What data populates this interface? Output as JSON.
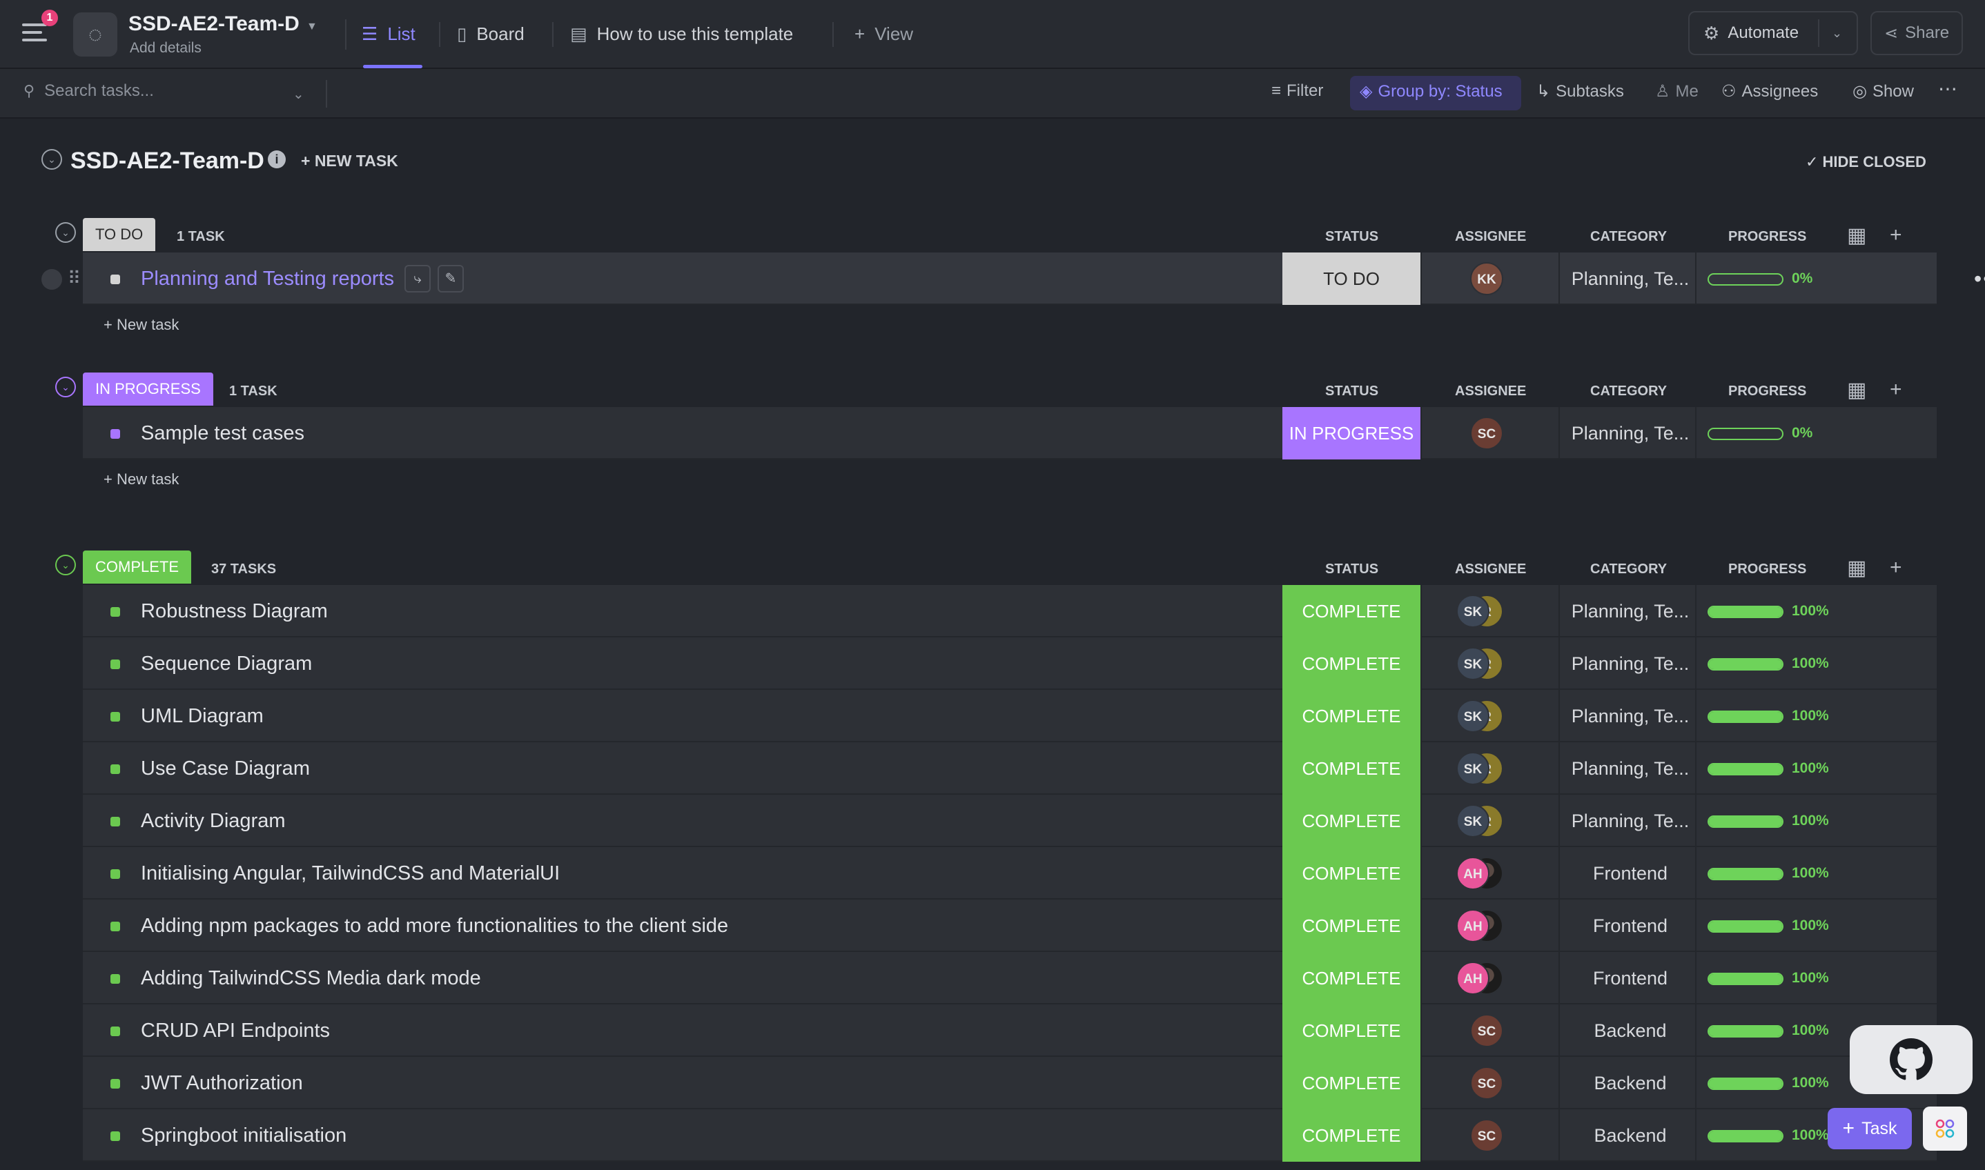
{
  "topbar": {
    "notification_count": "1",
    "workspace_name": "SSD-AE2-Team-D",
    "add_details": "Add details",
    "tabs": [
      {
        "label": "List",
        "icon": "list-icon",
        "active": true
      },
      {
        "label": "Board",
        "icon": "board-icon",
        "active": false
      },
      {
        "label": "How to use this template",
        "icon": "doc-icon",
        "active": false
      },
      {
        "label": "View",
        "icon": "plus-icon",
        "active": false
      }
    ],
    "automate_label": "Automate",
    "share_label": "Share"
  },
  "toolbar": {
    "search_placeholder": "Search tasks...",
    "filter_label": "Filter",
    "group_by_label": "Group by: Status",
    "subtasks_label": "Subtasks",
    "me_label": "Me",
    "assignees_label": "Assignees",
    "show_label": "Show"
  },
  "list": {
    "title": "SSD-AE2-Team-D",
    "new_task_label": "+ NEW TASK",
    "hide_closed_label": "HIDE CLOSED"
  },
  "columns": {
    "status": "STATUS",
    "assignee": "ASSIGNEE",
    "category": "CATEGORY",
    "progress": "PROGRESS"
  },
  "new_task_row_label": "+ New task",
  "colors": {
    "todo": "#d3d3d3",
    "in_progress": "#a875ff",
    "complete": "#6bc950",
    "accent": "#7b68ee",
    "progress": "#6ed35a"
  },
  "groups": {
    "todo": {
      "label": "TO DO",
      "count": "1 TASK",
      "tasks": [
        {
          "name": "Planning and Testing reports",
          "status": "TO DO",
          "assignees": [
            "KK"
          ],
          "category": "Planning, Te...",
          "progress": "0%"
        }
      ]
    },
    "in_progress": {
      "label": "IN PROGRESS",
      "count": "1 TASK",
      "tasks": [
        {
          "name": "Sample test cases",
          "status": "IN PROGRESS",
          "assignees": [
            "SC"
          ],
          "category": "Planning, Te...",
          "progress": "0%"
        }
      ]
    },
    "complete": {
      "label": "COMPLETE",
      "count": "37 TASKS",
      "tasks": [
        {
          "name": "Robustness Diagram",
          "status": "COMPLETE",
          "assignees": [
            "SK",
            "R"
          ],
          "category": "Planning, Te...",
          "progress": "100%"
        },
        {
          "name": "Sequence Diagram",
          "status": "COMPLETE",
          "assignees": [
            "SK",
            "R"
          ],
          "category": "Planning, Te...",
          "progress": "100%"
        },
        {
          "name": "UML Diagram",
          "status": "COMPLETE",
          "assignees": [
            "SK",
            "R"
          ],
          "category": "Planning, Te...",
          "progress": "100%"
        },
        {
          "name": "Use Case Diagram",
          "status": "COMPLETE",
          "assignees": [
            "SK",
            "R"
          ],
          "category": "Planning, Te...",
          "progress": "100%"
        },
        {
          "name": "Activity Diagram",
          "status": "COMPLETE",
          "assignees": [
            "SK",
            "R"
          ],
          "category": "Planning, Te...",
          "progress": "100%"
        },
        {
          "name": "Initialising Angular, TailwindCSS and MaterialUI",
          "status": "COMPLETE",
          "assignees": [
            "AH",
            "photo"
          ],
          "category": "Frontend",
          "progress": "100%"
        },
        {
          "name": "Adding npm packages to add more functionalities to the client side",
          "status": "COMPLETE",
          "assignees": [
            "AH",
            "photo"
          ],
          "category": "Frontend",
          "progress": "100%"
        },
        {
          "name": "Adding TailwindCSS Media dark mode",
          "status": "COMPLETE",
          "assignees": [
            "AH",
            "photo"
          ],
          "category": "Frontend",
          "progress": "100%"
        },
        {
          "name": "CRUD API Endpoints",
          "status": "COMPLETE",
          "assignees": [
            "SC"
          ],
          "category": "Backend",
          "progress": "100%"
        },
        {
          "name": "JWT Authorization",
          "status": "COMPLETE",
          "assignees": [
            "SC"
          ],
          "category": "Backend",
          "progress": "100%"
        },
        {
          "name": "Springboot initialisation",
          "status": "COMPLETE",
          "assignees": [
            "SC"
          ],
          "category": "Backend",
          "progress": "100%"
        }
      ]
    }
  },
  "floating": {
    "task_button_label": "Task",
    "github_icon": "github-icon",
    "apps_icon": "apps-icon"
  }
}
